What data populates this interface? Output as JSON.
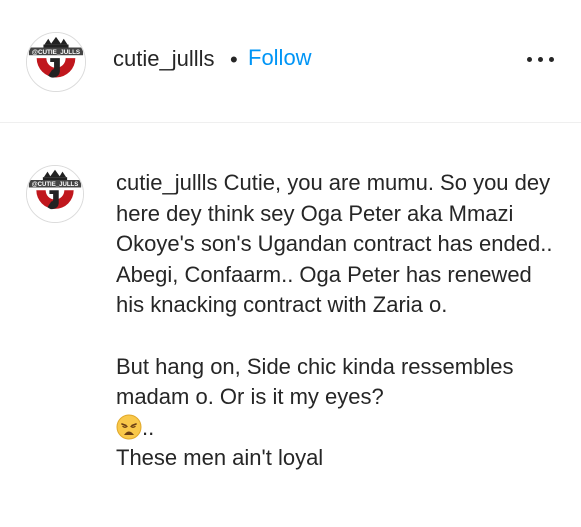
{
  "header": {
    "username": "cutie_jullls",
    "separator": "•",
    "follow_label": "Follow",
    "more_icon": "more-horizontal-icon"
  },
  "avatar": {
    "logo_text": "@CUTIE_JULLS",
    "monogram": "CJ",
    "brand_red": "#c0171d",
    "crown_color": "#222222"
  },
  "comment": {
    "username": "cutie_jullls",
    "text_1": "Cutie, you are mumu. So you dey here dey think sey Oga Peter aka Mmazi Okoye's son's Ugandan contract has ended.. Abegi, Confaarm.. Oga Peter has renewed his knacking contract with Zaria o.",
    "text_2": "But hang on, Side chic kinda ressembles madam o. Or is it my eyes?",
    "emoji_name": "weary-face-icon",
    "emoji_suffix": "..",
    "text_3": "These men ain't loyal"
  },
  "colors": {
    "link_blue": "#0095f6",
    "text": "#262626",
    "divider": "#efefef"
  }
}
